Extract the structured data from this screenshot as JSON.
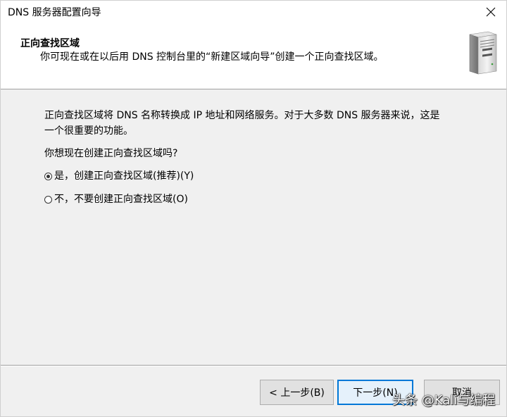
{
  "window": {
    "title": "DNS 服务器配置向导"
  },
  "header": {
    "title": "正向查找区域",
    "subtitle": "你可现在或在以后用 DNS 控制台里的“新建区域向导”创建一个正向查找区域。",
    "icon": "server-icon"
  },
  "content": {
    "description_line1": "正向查找区域将 DNS 名称转换成 IP 地址和网络服务。对于大多数 DNS 服务器来说，这是",
    "description_line2": "一个很重要的功能。",
    "question": "你想现在创建正向查找区域吗?",
    "options": [
      {
        "label": "是，创建正向查找区域(推荐)(Y)",
        "selected": true
      },
      {
        "label": "不，不要创建正向查找区域(O)",
        "selected": false
      }
    ]
  },
  "buttons": {
    "back": "< 上一步(B)",
    "next": "下一步(N)",
    "cancel": "取消"
  },
  "watermark": "头条 @Kali与编程",
  "colors": {
    "focus": "#0078d7",
    "window_bg": "#f0f0f0"
  }
}
